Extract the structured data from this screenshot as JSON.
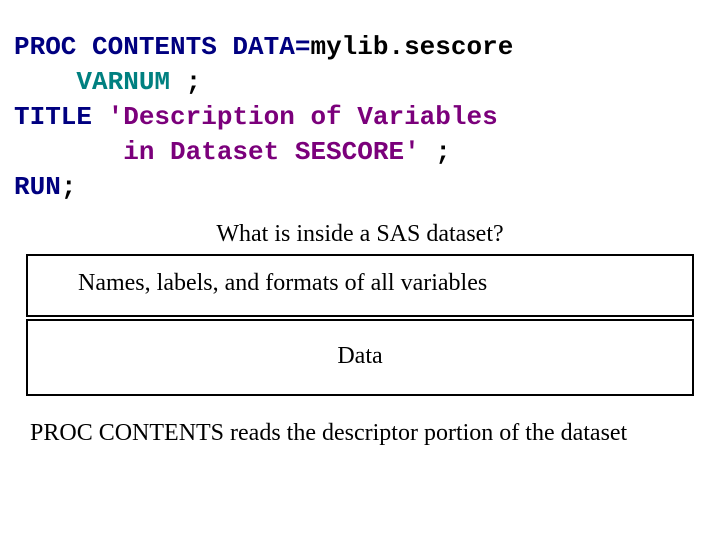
{
  "code": {
    "l1a": "PROC CONTENTS DATA",
    "l1b": "=",
    "l1c": "mylib.sescore",
    "l2a": "    VARNUM ",
    "l2b": ";",
    "l3a": "TITLE ",
    "l3b": "'Description of Variables",
    "l4a": "       in Dataset SESCORE' ",
    "l4b": ";",
    "l5a": "RUN",
    "l5b": ";"
  },
  "question": "What is inside a SAS dataset?",
  "box1": "Names, labels, and formats of all variables",
  "box2": "Data",
  "footer": "PROC CONTENTS reads the descriptor portion of the dataset"
}
